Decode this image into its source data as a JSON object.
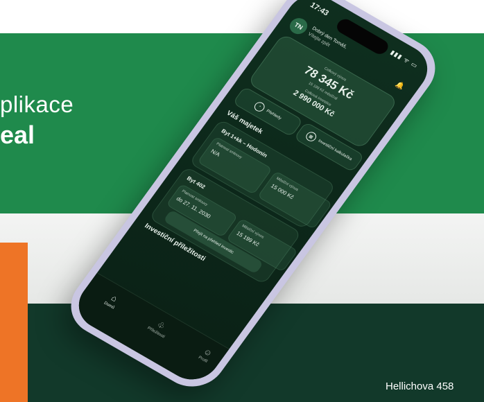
{
  "hero": {
    "line1": "plikace",
    "line2": "eal"
  },
  "address": "Hellichova 458",
  "colors": {
    "green": "#1f8a4c",
    "dark_green": "#12392a",
    "orange": "#ee7426",
    "phone_frame": "#c9c6e2"
  },
  "status_bar": {
    "time": "17:43",
    "icons": "▮▮▮ ᯤ ▭"
  },
  "header": {
    "avatar_initials": "TN",
    "greeting": "Dobrý den Tomáš,",
    "greeting_sub": "Vítejte zpět",
    "notification_icon": "bell-icon"
  },
  "summary": {
    "yield_label": "Celkový výnos",
    "yield_value": "78 345 Kč",
    "monthly_text": "15 199 Kč měsíčně",
    "invest_label": "Celková investice",
    "invest_value": "2 990 000 Kč"
  },
  "actions": {
    "overview_label": "Přehledy",
    "overview_icon": "pie-chart-icon",
    "calc_label": "Investiční kalkulačka",
    "calc_icon": "calculator-icon"
  },
  "assets": {
    "title": "Váš majetek",
    "items": [
      {
        "name": "Byt 1+kk – Hodonín",
        "contract_label": "Platnost smlouvy",
        "contract_value": "N/A",
        "yield_label": "Měsíční výnos",
        "yield_value": "15 000 Kč"
      },
      {
        "name": "Byt 402",
        "contract_label": "Platnost smlouvy",
        "contract_value": "do 27. 11. 2030",
        "yield_label": "Měsíční výnos",
        "yield_value": "15 199 Kč"
      }
    ],
    "link": "Přejít na přehled investic"
  },
  "opportunities_title": "Investiční příležitosti",
  "tabbar": [
    {
      "label": "Domů",
      "icon": "home-icon"
    },
    {
      "label": "Příležitosti",
      "icon": "sprout-icon"
    },
    {
      "label": "Profil",
      "icon": "profile-icon"
    }
  ]
}
